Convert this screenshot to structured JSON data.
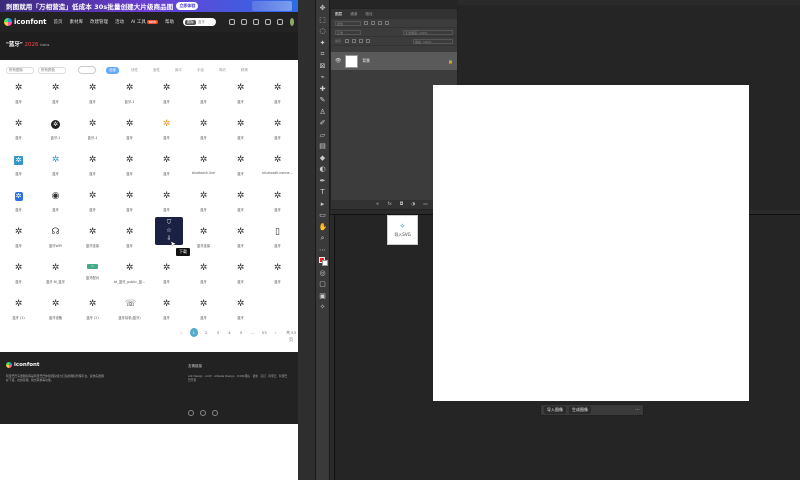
{
  "banner": {
    "text": "刺图就用「万相营造」低成本 30s批量创建大片级商品图",
    "cta": "立即体验"
  },
  "topnav": {
    "logo": "iconfont",
    "items": [
      "首页",
      "素材库",
      "改建管理",
      "活动",
      "AI 工具"
    ],
    "ai_badge": "NEW",
    "help": "帮助",
    "search_scope": "图标",
    "search_placeholder": "蓝牙"
  },
  "hero": {
    "title": "\"蓝牙\"",
    "count": "2026",
    "suffix": "icons"
  },
  "filters": {
    "dropdown1": "所有图标",
    "dropdown2": "所有颜色",
    "tabs": [
      "全部",
      "线性",
      "面性",
      "扁平",
      "手绘",
      "简约",
      "精美"
    ]
  },
  "grid": [
    [
      {
        "ic": "✲",
        "lb": "蓝牙"
      },
      {
        "ic": "✲",
        "lb": "蓝牙"
      },
      {
        "ic": "✲",
        "lb": "蓝牙"
      },
      {
        "ic": "✲",
        "lb": "蓝牙-1"
      },
      {
        "ic": "✲",
        "lb": "蓝牙"
      },
      {
        "ic": "✲",
        "lb": "蓝牙"
      },
      {
        "ic": "✲",
        "lb": "蓝牙"
      },
      {
        "ic": "✲",
        "lb": "蓝牙"
      }
    ],
    [
      {
        "ic": "✲",
        "lb": "蓝牙"
      },
      {
        "ic": "✲",
        "lb": "蓝牙-1",
        "cls": "blk"
      },
      {
        "ic": "✲",
        "lb": "蓝牙-1"
      },
      {
        "ic": "✲",
        "lb": "蓝牙"
      },
      {
        "ic": "✲",
        "lb": "蓝牙",
        "cls": "orange"
      },
      {
        "ic": "✲",
        "lb": "蓝牙"
      },
      {
        "ic": "✲",
        "lb": "蓝牙"
      },
      {
        "ic": "✲",
        "lb": "蓝牙"
      }
    ],
    [
      {
        "ic": "✲",
        "lb": "蓝牙",
        "cls": "sq"
      },
      {
        "ic": "✲",
        "lb": "蓝牙",
        "cls": "blue"
      },
      {
        "ic": "✲",
        "lb": "蓝牙"
      },
      {
        "ic": "✲",
        "lb": "蓝牙"
      },
      {
        "ic": "✲",
        "lb": "蓝牙"
      },
      {
        "ic": "✲",
        "lb": "bluetooth-line"
      },
      {
        "ic": "✲",
        "lb": "蓝牙"
      },
      {
        "ic": "✲",
        "lb": "bluetooth-conne..."
      }
    ],
    [
      {
        "ic": "✲",
        "lb": "蓝牙",
        "cls": "sqb"
      },
      {
        "ic": "◉",
        "lb": "蓝牙"
      },
      {
        "ic": "✲",
        "lb": "蓝牙"
      },
      {
        "ic": "✲",
        "lb": "蓝牙"
      },
      {
        "ic": "✲",
        "lb": "蓝牙"
      },
      {
        "ic": "✲",
        "lb": "蓝牙"
      },
      {
        "ic": "✲",
        "lb": "蓝牙"
      },
      {
        "ic": "✲",
        "lb": "蓝牙"
      }
    ],
    [
      {
        "ic": "✲",
        "lb": "蓝牙"
      },
      {
        "ic": "☊",
        "lb": "蓝牙WiFi"
      },
      {
        "ic": "✲",
        "lb": "蓝牙连接"
      },
      {
        "ic": "✲",
        "lb": "蓝牙"
      },
      {
        "ic": "",
        "lb": ""
      },
      {
        "ic": "✲",
        "lb": "蓝牙连接"
      },
      {
        "ic": "✲",
        "lb": "蓝牙"
      },
      {
        "ic": "▯",
        "lb": "蓝牙"
      }
    ],
    [
      {
        "ic": "✲",
        "lb": "蓝牙"
      },
      {
        "ic": "✲",
        "lb": "蓝牙 Bl_蓝牙"
      },
      {
        "ic": "▭",
        "lb": "蓝牙配对",
        "cls": "pill"
      },
      {
        "ic": "✲",
        "lb": "bt_蓝牙_public_蓝..."
      },
      {
        "ic": "✲",
        "lb": "蓝牙"
      },
      {
        "ic": "✲",
        "lb": "蓝牙"
      },
      {
        "ic": "✲",
        "lb": "蓝牙"
      },
      {
        "ic": "✲",
        "lb": "蓝牙"
      }
    ],
    [
      {
        "ic": "✲",
        "lb": "蓝牙 (1)"
      },
      {
        "ic": "✲",
        "lb": "蓝牙设备"
      },
      {
        "ic": "✲",
        "lb": "蓝牙 (2)"
      },
      {
        "ic": "☏",
        "lb": "蓝牙耳机(蓝牙)"
      },
      {
        "ic": "✲",
        "lb": "蓝牙"
      },
      {
        "ic": "✲",
        "lb": "蓝牙"
      },
      {
        "ic": "✲",
        "lb": "蓝牙"
      },
      {
        "ic": "",
        "lb": ""
      }
    ]
  ],
  "hovercard": {
    "cart": "⛉",
    "star": "☆",
    "download": "⇩",
    "tooltip": "下载"
  },
  "pager": {
    "pages": [
      "‹",
      "1",
      "2",
      "3",
      "4",
      "5",
      "…",
      "53",
      "›"
    ],
    "current": "1",
    "jump": "共 53 页"
  },
  "footer": {
    "logo": "iconfont",
    "about": "阿里巴巴矢量图标库是阿里巴巴体验团队倾力打造的图标管理平台，提供矢量图标下载、在线存储、格式转换等功能。",
    "right_title": "友情链接",
    "right_links": "Ant Design · AntV · Alibaba Design · ICON 图标 · 语雀 · 钉钉 · 阿里云 · 阿里巴巴开源"
  },
  "ps": {
    "tabs": [
      "图层",
      "通道",
      "路径"
    ],
    "search_label": "类型",
    "mode_label": "正常",
    "opacity_label": "不透明度: 100%",
    "lock_label": "锁定:",
    "fill_label": "填充: 100%",
    "layer_name": "背景",
    "import_svg": "导入SVG",
    "bottom_import": "导入图像",
    "bottom_generate": "生成图像"
  },
  "colors": {
    "accent": "#66aaff",
    "foreground_swatch": "#ee2222",
    "hover_card": "#1b2142"
  }
}
